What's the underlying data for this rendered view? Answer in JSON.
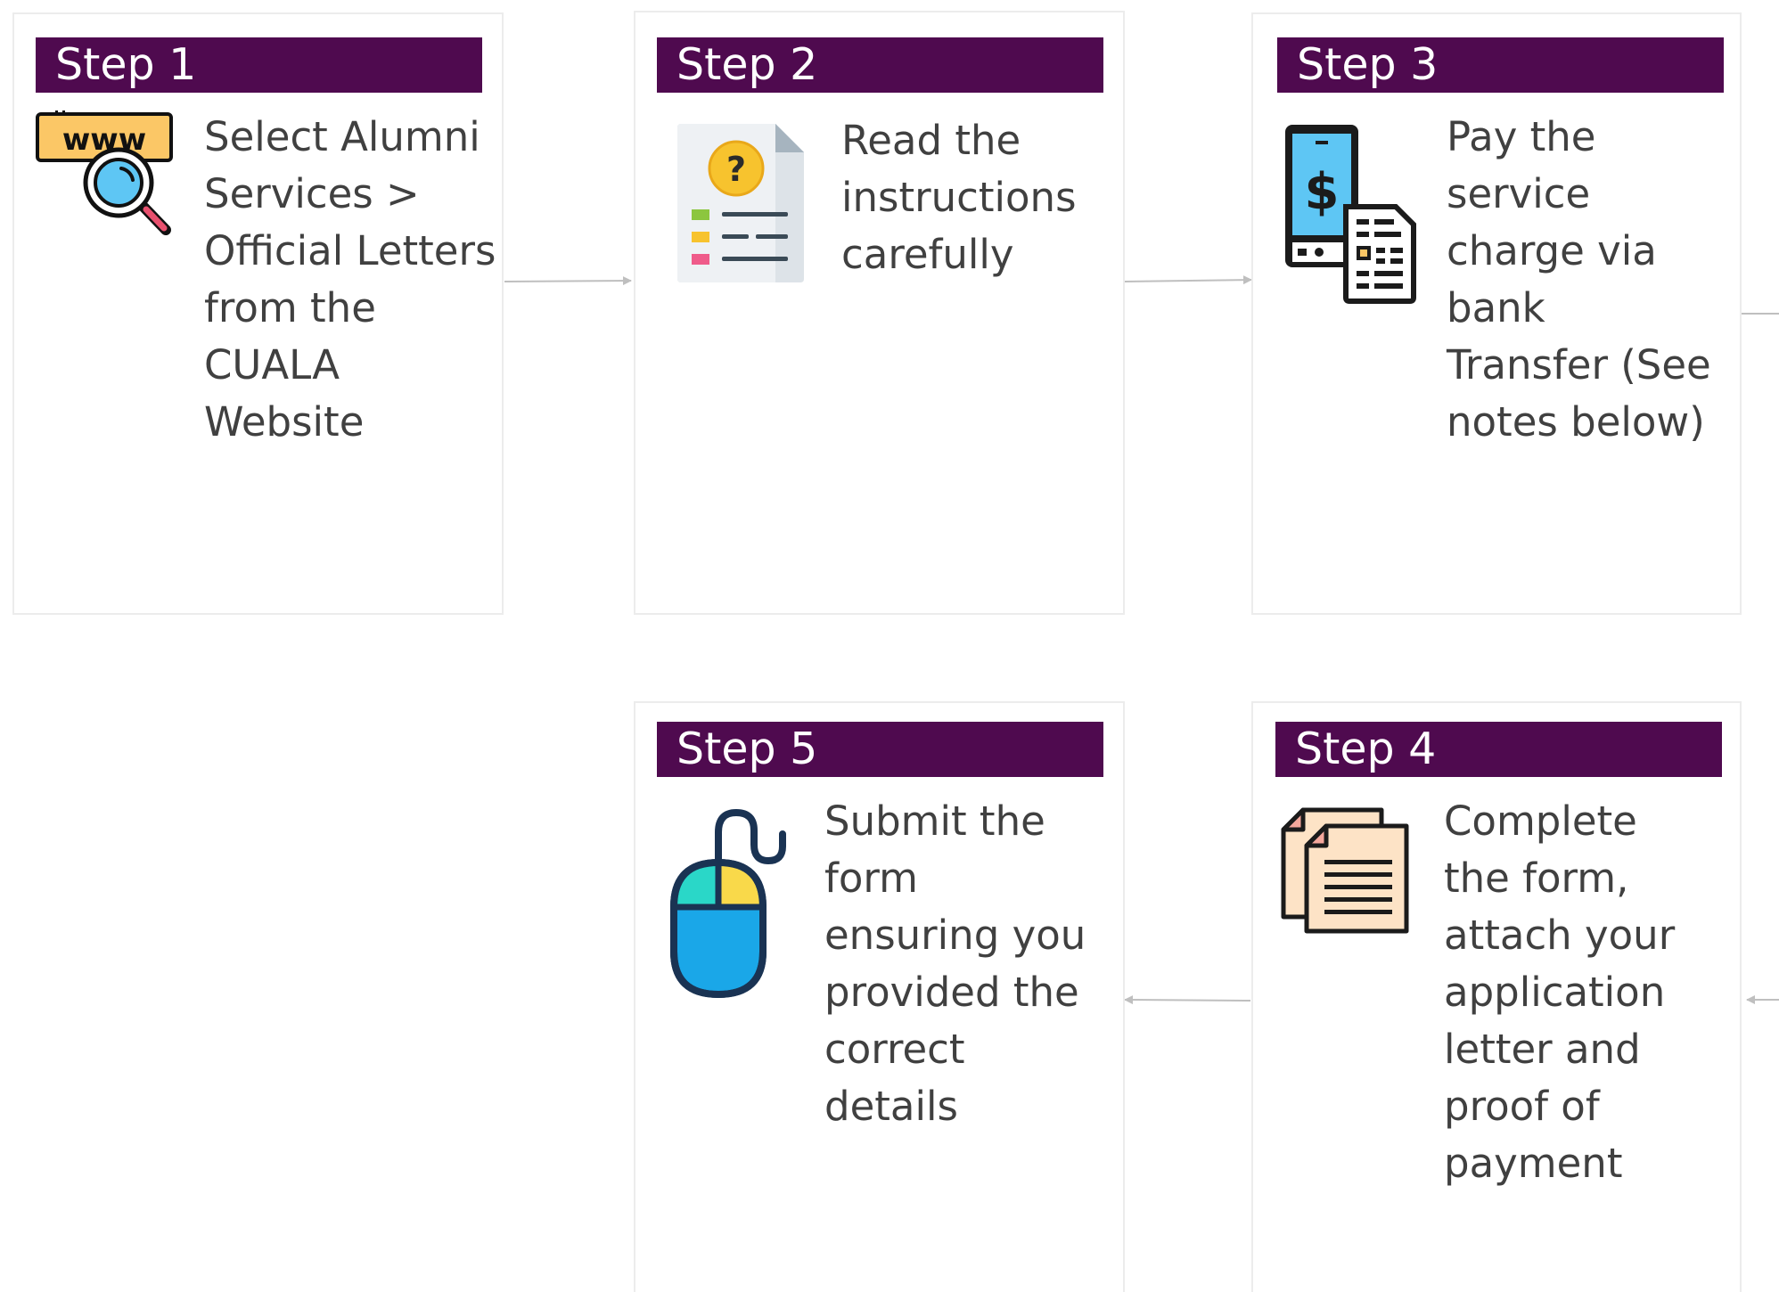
{
  "colors": {
    "header_bg": "#4f0a4f",
    "header_text": "#ffffff",
    "body_text": "#404040",
    "card_border": "#ececec",
    "connector": "#bfbfbf"
  },
  "steps": [
    {
      "label": "Step 1",
      "text": "Select Alumni\nServices >\nOfficial Letters\nfrom the\nCUALA\nWebsite",
      "icon": "www-search-icon"
    },
    {
      "label": "Step 2",
      "text": "Read the\ninstructions\ncarefully",
      "icon": "document-question-icon"
    },
    {
      "label": "Step 3",
      "text": "Pay the\nservice\ncharge via\nbank\nTransfer (See\nnotes below)",
      "icon": "mobile-payment-receipt-icon"
    },
    {
      "label": "Step 4",
      "text": "Complete\nthe form,\nattach your\napplication\nletter and\nproof of\npayment",
      "icon": "documents-icon"
    },
    {
      "label": "Step 5",
      "text": "Submit the\nform\nensuring you\nprovided the\ncorrect\ndetails",
      "icon": "computer-mouse-icon"
    }
  ]
}
